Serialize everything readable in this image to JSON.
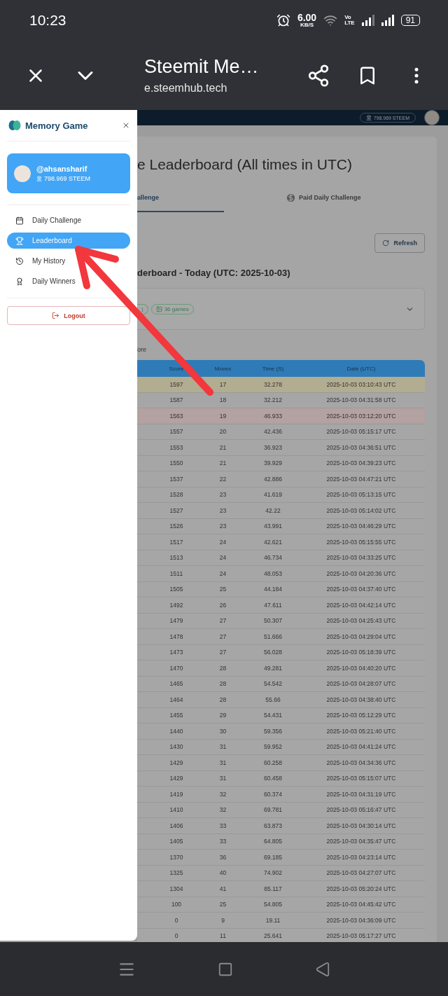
{
  "status_bar": {
    "time": "10:23",
    "speed": "6.00",
    "speed_unit": "KB/S",
    "volte": [
      "Vo",
      "LTE"
    ],
    "battery": "91"
  },
  "browser": {
    "title": "Steemit Me…",
    "url": "e.steemhub.tech"
  },
  "site_header": {
    "balance": "798.969 STEEM"
  },
  "drawer": {
    "title": "Memory Game",
    "user": {
      "name": "@ahsansharif",
      "balance": "798.969 STEEM"
    },
    "nav": [
      {
        "label": "Daily Challenge",
        "selected": false
      },
      {
        "label": "Leaderboard",
        "selected": true
      },
      {
        "label": "My History",
        "selected": false
      },
      {
        "label": "Daily Winners",
        "selected": false
      }
    ],
    "logout": "Logout"
  },
  "page": {
    "title": "e Leaderboard (All times in UTC)",
    "tabs": [
      {
        "label": "allenge",
        "selected": true
      },
      {
        "label": "Paid Daily Challenge",
        "selected": false
      }
    ],
    "refresh": "Refresh",
    "subtitle": "derboard - Today (UTC: 2025-10-03)",
    "summary": {
      "chips": [
        ")",
        "36 games"
      ]
    },
    "note": "ore",
    "table": {
      "columns": [
        "Score",
        "Moves",
        "Time (S)",
        "Date (UTC)"
      ],
      "rows": [
        {
          "cells": [
            "1597",
            "17",
            "32.278",
            "2025-10-03 03:10:43 UTC"
          ],
          "color": "#b2ad90"
        },
        {
          "cells": [
            "1587",
            "18",
            "32.212",
            "2025-10-03 04:31:58 UTC"
          ]
        },
        {
          "cells": [
            "1563",
            "19",
            "46.933",
            "2025-10-03 03:12:20 UTC"
          ],
          "color": "#b4a1a1"
        },
        {
          "cells": [
            "1557",
            "20",
            "42.436",
            "2025-10-03 05:15:17 UTC"
          ]
        },
        {
          "cells": [
            "1553",
            "21",
            "36.923",
            "2025-10-03 04:36:51 UTC"
          ]
        },
        {
          "cells": [
            "1550",
            "21",
            "39.929",
            "2025-10-03 04:39:23 UTC"
          ]
        },
        {
          "cells": [
            "1537",
            "22",
            "42.886",
            "2025-10-03 04:47:21 UTC"
          ]
        },
        {
          "cells": [
            "1528",
            "23",
            "41.619",
            "2025-10-03 05:13:15 UTC"
          ]
        },
        {
          "cells": [
            "1527",
            "23",
            "42.22",
            "2025-10-03 05:14:02 UTC"
          ]
        },
        {
          "cells": [
            "1526",
            "23",
            "43.991",
            "2025-10-03 04:46:29 UTC"
          ]
        },
        {
          "cells": [
            "1517",
            "24",
            "42.621",
            "2025-10-03 05:15:55 UTC"
          ]
        },
        {
          "cells": [
            "1513",
            "24",
            "46.734",
            "2025-10-03 04:33:25 UTC"
          ]
        },
        {
          "cells": [
            "1511",
            "24",
            "48.053",
            "2025-10-03 04:20:36 UTC"
          ]
        },
        {
          "cells": [
            "1505",
            "25",
            "44.184",
            "2025-10-03 04:37:40 UTC"
          ]
        },
        {
          "cells": [
            "1492",
            "26",
            "47.611",
            "2025-10-03 04:42:14 UTC"
          ]
        },
        {
          "cells": [
            "1479",
            "27",
            "50.307",
            "2025-10-03 04:25:43 UTC"
          ]
        },
        {
          "cells": [
            "1478",
            "27",
            "51.666",
            "2025-10-03 04:29:04 UTC"
          ]
        },
        {
          "cells": [
            "1473",
            "27",
            "56.028",
            "2025-10-03 05:18:39 UTC"
          ]
        },
        {
          "cells": [
            "1470",
            "28",
            "49.281",
            "2025-10-03 04:40:20 UTC"
          ]
        },
        {
          "cells": [
            "1465",
            "28",
            "54.542",
            "2025-10-03 04:28:07 UTC"
          ]
        },
        {
          "cells": [
            "1464",
            "28",
            "55.66",
            "2025-10-03 04:38:40 UTC"
          ]
        },
        {
          "cells": [
            "1455",
            "29",
            "54.431",
            "2025-10-03 05:12:29 UTC"
          ]
        },
        {
          "cells": [
            "1440",
            "30",
            "59.356",
            "2025-10-03 05:21:40 UTC"
          ]
        },
        {
          "cells": [
            "1430",
            "31",
            "59.952",
            "2025-10-03 04:41:24 UTC"
          ]
        },
        {
          "cells": [
            "1429",
            "31",
            "60.258",
            "2025-10-03 04:34:36 UTC"
          ]
        },
        {
          "cells": [
            "1429",
            "31",
            "60.458",
            "2025-10-03 05:15:07 UTC"
          ]
        },
        {
          "cells": [
            "1419",
            "32",
            "60.374",
            "2025-10-03 04:31:19 UTC"
          ]
        },
        {
          "cells": [
            "1410",
            "32",
            "69.781",
            "2025-10-03 05:16:47 UTC"
          ]
        },
        {
          "cells": [
            "1406",
            "33",
            "63.873",
            "2025-10-03 04:30:14 UTC"
          ]
        },
        {
          "cells": [
            "1405",
            "33",
            "64.805",
            "2025-10-03 04:35:47 UTC"
          ]
        },
        {
          "cells": [
            "1370",
            "36",
            "69.185",
            "2025-10-03 04:23:14 UTC"
          ]
        },
        {
          "cells": [
            "1325",
            "40",
            "74.902",
            "2025-10-03 04:27:07 UTC"
          ]
        },
        {
          "cells": [
            "1304",
            "41",
            "85.117",
            "2025-10-03 05:20:24 UTC"
          ]
        },
        {
          "cells": [
            "100",
            "25",
            "54.805",
            "2025-10-03 04:45:42 UTC"
          ]
        },
        {
          "cells": [
            "0",
            "9",
            "19.11",
            "2025-10-03 04:36:09 UTC"
          ]
        },
        {
          "cells": [
            "0",
            "11",
            "25.641",
            "2025-10-03 05:17:27 UTC"
          ]
        }
      ]
    }
  }
}
